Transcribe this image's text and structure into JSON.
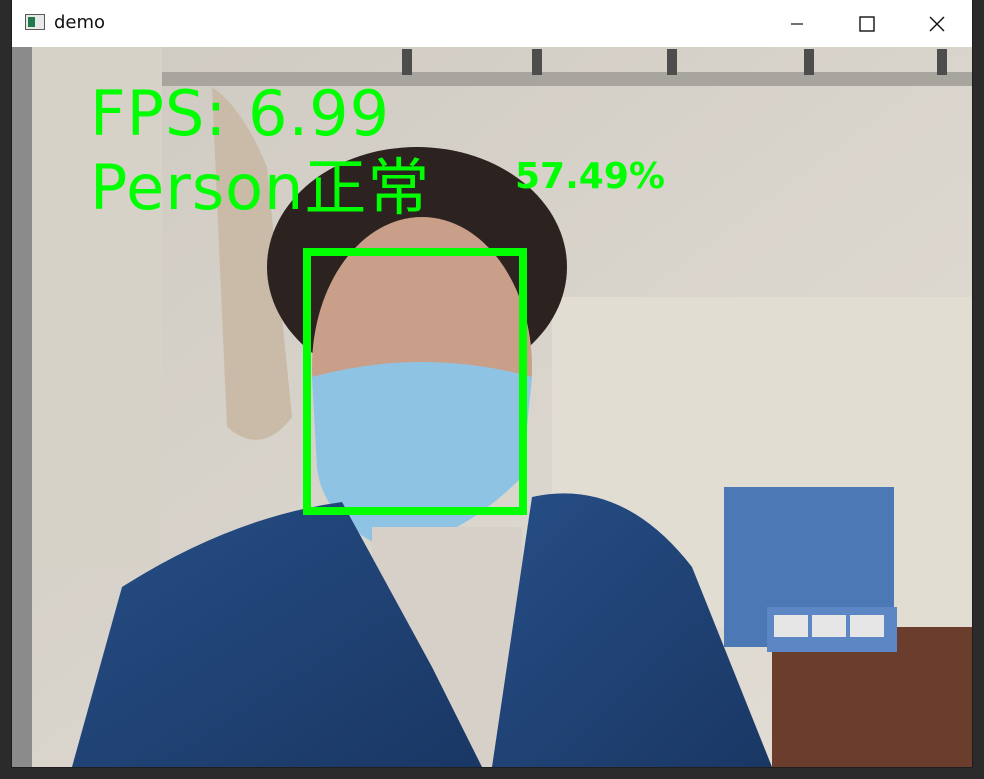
{
  "window": {
    "title": "demo",
    "icon": "app-window-icon",
    "controls": {
      "minimize_icon": "minimize-icon",
      "maximize_icon": "maximize-icon",
      "close_icon": "close-icon"
    }
  },
  "overlay": {
    "fps_text": "FPS: 6.99",
    "class_label": "Person正常",
    "confidence": "57.49%",
    "color": "#00ff00"
  }
}
